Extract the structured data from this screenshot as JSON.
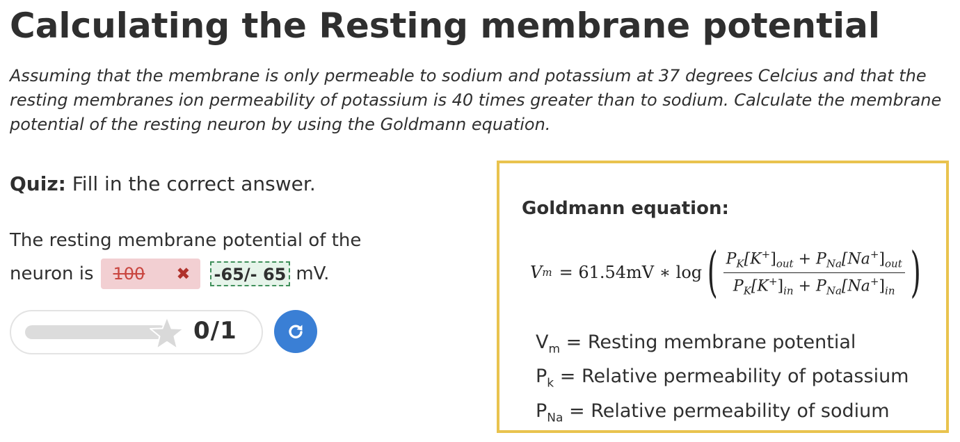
{
  "title": "Calculating the Resting membrane potential",
  "intro": "Assuming that the membrane is only permeable to sodium and potassium at 37 degrees Celcius and that the resting membranes ion permeability of potassium is 40 times greater than to sodium. Calculate the membrane potential of the resting neuron by using the Goldmann equation.",
  "quiz": {
    "label": "Quiz:",
    "instruction": "Fill in the correct answer.",
    "question_part1": "The resting membrane potential of the",
    "question_part2": "neuron is",
    "user_answer": "100",
    "correct_answer": "-65/- 65",
    "unit": "mV."
  },
  "score": {
    "text": "0/1",
    "progress_fraction": 0
  },
  "equation_panel": {
    "heading": "Goldmann equation:",
    "equation": {
      "lhs": "V",
      "lhs_sub": "m",
      "constant": "= 61.54mV ∗ log",
      "num_pk": "P",
      "num_pk_sub": "K",
      "num_k": "[K",
      "num_k_sup": "+",
      "num_k_close": "]",
      "num_k_sub": "out",
      "plus": " + ",
      "num_pna": "P",
      "num_pna_sub": "Na",
      "num_na": "[Na",
      "num_na_sup": "+",
      "num_na_close": "]",
      "num_na_sub": "out",
      "den_k_sub": "in",
      "den_na_sub": "in"
    },
    "definitions": [
      {
        "symbol": "V",
        "sub": "m",
        "text": " = Resting membrane potential"
      },
      {
        "symbol": "P",
        "sub": "k",
        "text": " = Relative permeability of potassium"
      },
      {
        "symbol": "P",
        "sub": "Na",
        "text": " = Relative permeability of sodium"
      }
    ]
  },
  "colors": {
    "panel_border": "#e9c34e",
    "wrong_bg": "#f2cfd2",
    "wrong_text": "#c9453f",
    "correct_border": "#3f8f5a",
    "retry_button": "#3a7fd5"
  },
  "icons": {
    "wrong": "cross-icon",
    "score": "star-icon",
    "retry": "retry-icon"
  }
}
